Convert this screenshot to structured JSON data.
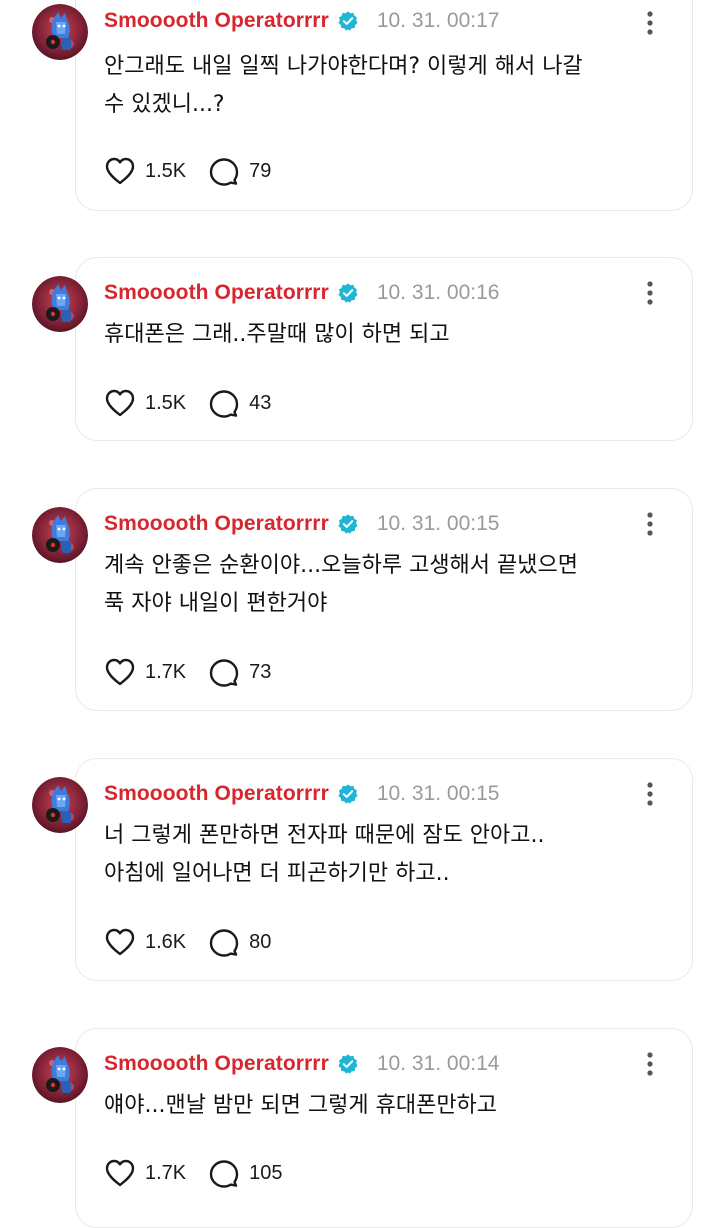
{
  "posts": [
    {
      "author": "Smooooth Operatorrrr",
      "time": "10. 31. 00:17",
      "text_lines": [
        "안그래도 내일 일찍 나가야한다며? 이렇게 해서 나갈",
        "수 있겠니...?"
      ],
      "likes": "1.5K",
      "replies": "79"
    },
    {
      "author": "Smooooth Operatorrrr",
      "time": "10. 31. 00:16",
      "text_lines": [
        "휴대폰은 그래..주말때 많이 하면 되고"
      ],
      "likes": "1.5K",
      "replies": "43"
    },
    {
      "author": "Smooooth Operatorrrr",
      "time": "10. 31. 00:15",
      "text_lines": [
        "계속 안좋은 순환이야...오늘하루 고생해서 끝냈으면",
        "푹 자야 내일이 편한거야"
      ],
      "likes": "1.7K",
      "replies": "73"
    },
    {
      "author": "Smooooth Operatorrrr",
      "time": "10. 31. 00:15",
      "text_lines": [
        "너 그렇게 폰만하면 전자파 때문에 잠도 안아고..",
        "아침에 일어나면 더 피곤하기만 하고.."
      ],
      "likes": "1.6K",
      "replies": "80"
    },
    {
      "author": "Smooooth Operatorrrr",
      "time": "10. 31. 00:14",
      "text_lines": [
        "얘야...맨날 밤만 되면 그렇게 휴대폰만하고"
      ],
      "likes": "1.7K",
      "replies": "105"
    }
  ],
  "icons": {
    "verified": "verified-badge-icon",
    "more": "more-vertical-icon",
    "like": "heart-icon",
    "reply": "speech-bubble-icon"
  },
  "colors": {
    "author": "#d7262d",
    "verified": "#1fb6d6",
    "time": "#9a9a9a",
    "card_border": "#e8e8e8"
  }
}
